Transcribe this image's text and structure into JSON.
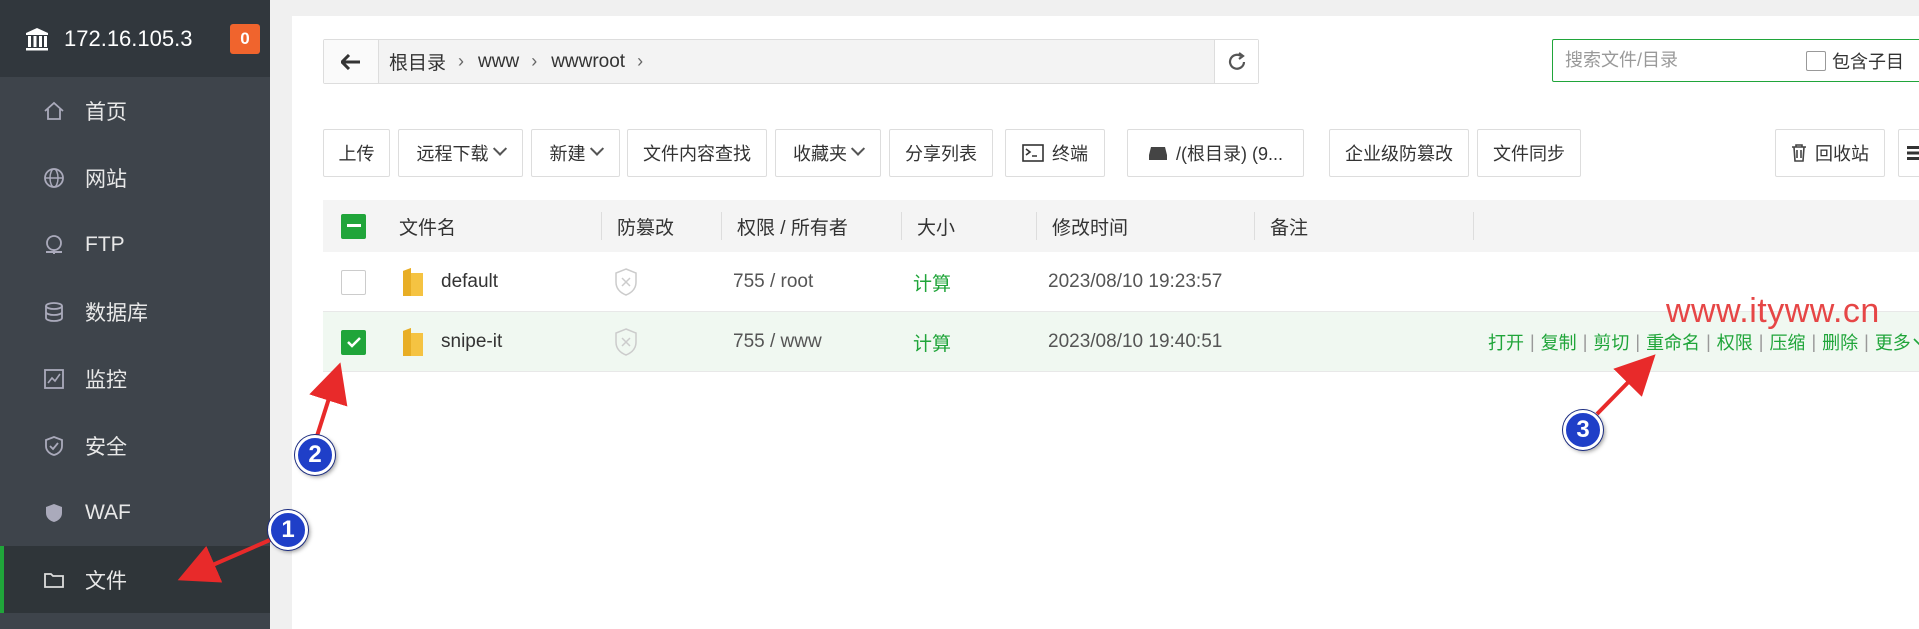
{
  "sidebar": {
    "server_ip": "172.16.105.3",
    "badge_count": "0",
    "items": [
      {
        "label": "首页",
        "icon": "home-icon"
      },
      {
        "label": "网站",
        "icon": "globe-icon"
      },
      {
        "label": "FTP",
        "icon": "ftp-icon"
      },
      {
        "label": "数据库",
        "icon": "database-icon"
      },
      {
        "label": "监控",
        "icon": "monitor-icon"
      },
      {
        "label": "安全",
        "icon": "shield-icon"
      },
      {
        "label": "WAF",
        "icon": "waf-shield-icon"
      },
      {
        "label": "文件",
        "icon": "folder-icon",
        "active": true
      }
    ]
  },
  "pathbar": {
    "crumbs": [
      "根目录",
      "www",
      "wwwroot"
    ]
  },
  "search": {
    "placeholder": "搜索文件/目录",
    "include_subdir_label": "包含子目"
  },
  "toolbar": {
    "upload": "上传",
    "remote_download": "远程下载",
    "new": "新建",
    "content_search": "文件内容查找",
    "favorites": "收藏夹",
    "share_list": "分享列表",
    "terminal": "终端",
    "disk": "/(根目录) (9...",
    "tamper_proof": "企业级防篡改",
    "file_sync": "文件同步",
    "recycle_bin": "回收站"
  },
  "table": {
    "headers": {
      "name": "文件名",
      "tamper": "防篡改",
      "perm": "权限 / 所有者",
      "size": "大小",
      "mtime": "修改时间",
      "remark": "备注"
    },
    "rows": [
      {
        "name": "default",
        "perm": "755 / root",
        "size": "计算",
        "mtime": "2023/08/10 19:23:57",
        "checked": false
      },
      {
        "name": "snipe-it",
        "perm": "755 / www",
        "size": "计算",
        "mtime": "2023/08/10 19:40:51",
        "checked": true
      }
    ],
    "row_ops": [
      "打开",
      "复制",
      "剪切",
      "重命名",
      "权限",
      "压缩",
      "删除",
      "更多"
    ]
  },
  "watermark": "www.ityww.cn",
  "markers": [
    "1",
    "2",
    "3"
  ],
  "colors": {
    "accent": "#20a53a",
    "sidebar_bg": "#3e444b",
    "badge": "#f0642d",
    "marker": "#1f3fc8",
    "arrow": "#e82a2a"
  }
}
